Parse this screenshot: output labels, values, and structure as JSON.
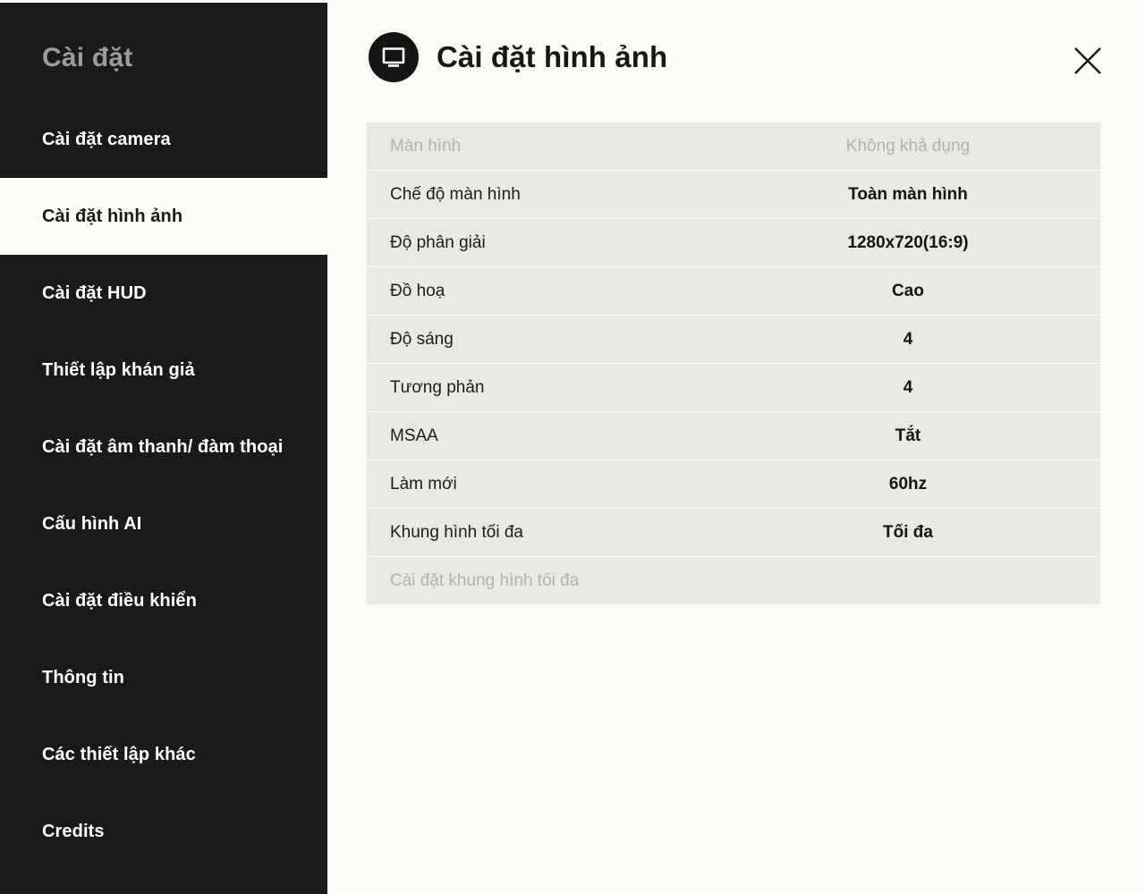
{
  "sidebar": {
    "title": "Cài đặt",
    "items": [
      {
        "label": "Cài đặt camera",
        "active": false
      },
      {
        "label": "Cài đặt hình ảnh",
        "active": true
      },
      {
        "label": "Cài đặt HUD",
        "active": false
      },
      {
        "label": "Thiết lập khán giả",
        "active": false
      },
      {
        "label": "Cài đặt âm thanh/ đàm thoại",
        "active": false
      },
      {
        "label": "Cấu hình AI",
        "active": false
      },
      {
        "label": "Cài đặt điều khiển",
        "active": false
      },
      {
        "label": "Thông tin",
        "active": false
      },
      {
        "label": "Các thiết lập khác",
        "active": false
      },
      {
        "label": "Credits",
        "active": false
      }
    ]
  },
  "panel": {
    "title": "Cài đặt hình ảnh",
    "icon": "monitor-icon",
    "close_icon": "close-icon"
  },
  "settings": {
    "rows": [
      {
        "label": "Màn hình",
        "value": "Không khả dụng",
        "disabled": true
      },
      {
        "label": "Chế độ màn hình",
        "value": "Toàn màn hình",
        "disabled": false
      },
      {
        "label": "Độ phân giải",
        "value": "1280x720(16:9)",
        "disabled": false
      },
      {
        "label": "Đồ hoạ",
        "value": "Cao",
        "disabled": false
      },
      {
        "label": "Độ sáng",
        "value": "4",
        "disabled": false
      },
      {
        "label": "Tương phản",
        "value": "4",
        "disabled": false
      },
      {
        "label": "MSAA",
        "value": "Tắt",
        "disabled": false
      },
      {
        "label": "Làm mới",
        "value": "60hz",
        "disabled": false
      },
      {
        "label": "Khung hình tối đa",
        "value": "Tối đa",
        "disabled": false
      },
      {
        "label": "Cài đặt khung hình tối đa",
        "value": "",
        "disabled": true
      }
    ]
  },
  "support": {
    "icon": "support-chat-icon"
  },
  "colors": {
    "sidebar_bg": "#1a1a1a",
    "panel_bg": "#fbfaf5",
    "row_bg": "#e9e8e3",
    "text_primary": "#141414",
    "text_disabled": "#b3b1ad",
    "sidebar_title": "#9c9c9c"
  }
}
